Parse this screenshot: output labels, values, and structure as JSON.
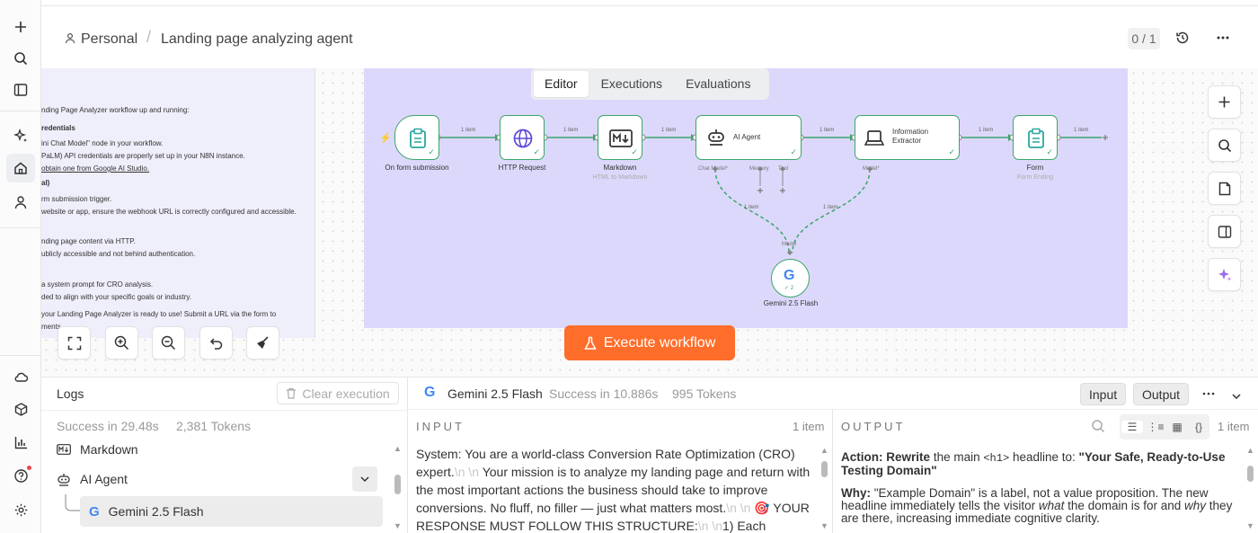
{
  "header": {
    "project": "Personal",
    "workflow_name": "Landing page analyzing agent",
    "counter": "0 / 1"
  },
  "canvas_tabs": [
    "Editor",
    "Executions",
    "Evaluations"
  ],
  "sticky_note": {
    "lines": [
      "nding Page Analyzer workflow up and running:",
      "redentials",
      "ini Chat Model\" node in your workflow.",
      "PaLM) API credentials are properly set up in your N8N instance.",
      "obtain one from Google AI Studio.",
      "al)",
      "rm submission trigger.",
      " website or app, ensure the webhook URL is correctly configured and accessible.",
      "nding page content via HTTP.",
      "ublicly accessible and not behind authentication.",
      "a system prompt for CRO analysis.",
      "ded to align with your specific goals or industry.",
      "your Landing Page Analyzer is ready to use! Submit a URL via the form to",
      "ments."
    ]
  },
  "workflow": {
    "nodes": {
      "trigger": {
        "label": "On form submission"
      },
      "http": {
        "label": "HTTP Request"
      },
      "markdown": {
        "label": "Markdown",
        "sub": "HTML to Markdown"
      },
      "agent": {
        "label": "AI Agent",
        "ports": [
          "Chat Model*",
          "Memory",
          "Tool"
        ]
      },
      "extractor": {
        "label": "Information Extractor",
        "ports": [
          "Model*"
        ]
      },
      "form": {
        "label": "Form",
        "sub": "Form Ending"
      },
      "gemini": {
        "label": "Gemini 2.5 Flash",
        "port": "Model",
        "badge": "2"
      }
    },
    "edge_label": "1 item"
  },
  "execute_button": {
    "label": "Execute workflow"
  },
  "logs": {
    "title": "Logs",
    "clear_label": "Clear execution",
    "status": "Success in 29.48s",
    "tokens": "2,381 Tokens",
    "entries": [
      {
        "label": "Markdown",
        "icon": "markdown-icon"
      },
      {
        "label": "AI Agent",
        "icon": "robot-icon"
      },
      {
        "label": "Gemini 2.5 Flash",
        "icon": "google-icon"
      }
    ]
  },
  "detail": {
    "title": "Gemini 2.5 Flash",
    "status": "Success in 10.886s",
    "tokens": "995 Tokens",
    "input_button": "Input",
    "output_button": "Output",
    "input_label": "INPUT",
    "input_count": "1 item",
    "output_label": "OUTPUT",
    "output_count": "1 item",
    "input_parts": [
      {
        "t": "System: You are a world-class Conversion Rate Optimization (CRO) expert.",
        "esc": false
      },
      {
        "t": "\\n \\n",
        "esc": true
      },
      {
        "t": " Your mission is to analyze my landing page and return with the most important actions the business should take to improve conversions. No fluff, no filler — just what matters most.",
        "esc": false
      },
      {
        "t": "\\n \\n",
        "esc": true
      },
      {
        "t": " 🎯 YOUR RESPONSE MUST FOLLOW THIS STRUCTURE:",
        "esc": false
      },
      {
        "t": "\\n \\n",
        "esc": true
      },
      {
        "t": "1) Each",
        "esc": false
      }
    ],
    "output": {
      "action_label": "Action:",
      "action_verb": "Rewrite",
      "action_mid": "the main",
      "action_code": "<h1>",
      "action_tail": "headline to:",
      "action_quote": "\"Your Safe, Ready-to-Use Testing Domain\"",
      "why_label": "Why:",
      "why_a": "\"Example Domain\" is a label, not a value proposition. The new headline immediately tells the visitor",
      "why_em1": "what",
      "why_b": "the domain is for and",
      "why_em2": "why",
      "why_c": "they are there, increasing immediate cognitive clarity."
    }
  }
}
